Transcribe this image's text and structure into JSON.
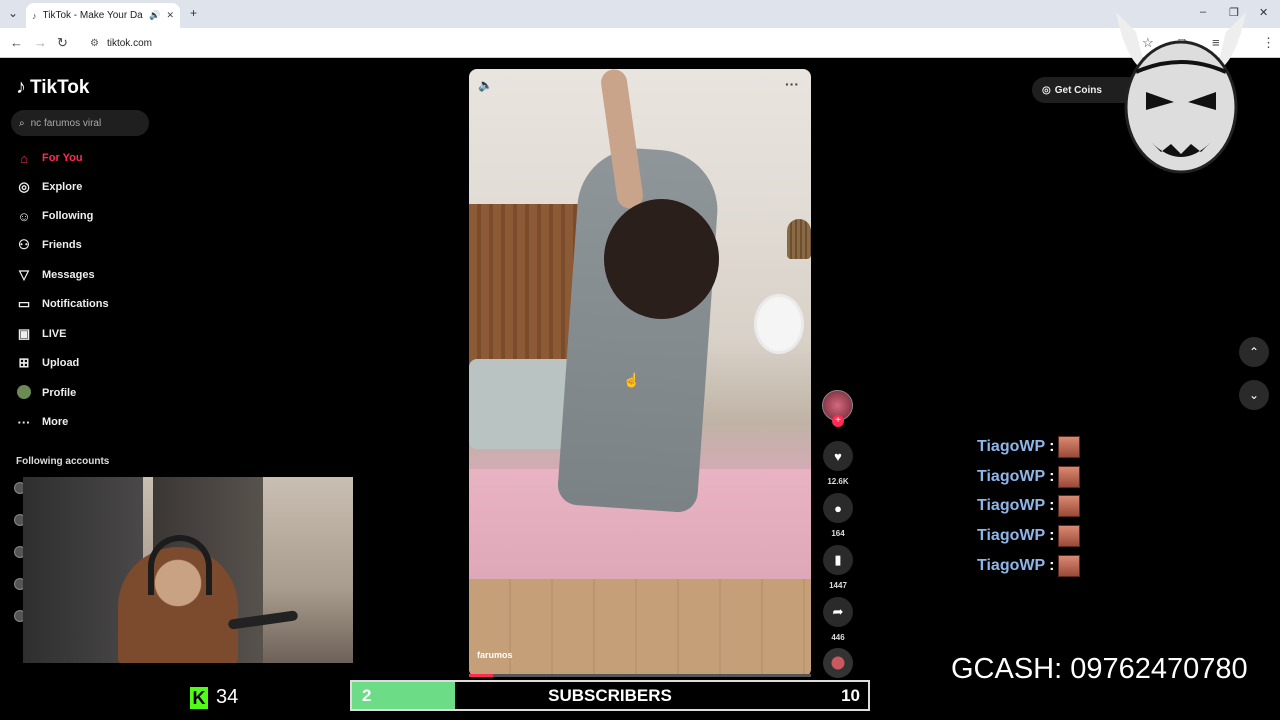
{
  "browser": {
    "tab_title": "TikTok - Make Your Day",
    "url": "tiktok.com"
  },
  "tiktok": {
    "logo_text": "TikTok",
    "search": {
      "value": "nc farumos viral"
    },
    "nav": [
      {
        "label": "For You",
        "icon": "home-icon"
      },
      {
        "label": "Explore",
        "icon": "compass-icon"
      },
      {
        "label": "Following",
        "icon": "person-follow-icon"
      },
      {
        "label": "Friends",
        "icon": "friends-icon"
      },
      {
        "label": "Messages",
        "icon": "send-icon"
      },
      {
        "label": "Notifications",
        "icon": "bell-icon"
      },
      {
        "label": "LIVE",
        "icon": "live-icon"
      },
      {
        "label": "Upload",
        "icon": "plus-square-icon"
      },
      {
        "label": "Profile",
        "icon": "avatar"
      },
      {
        "label": "More",
        "icon": "ellipsis-icon"
      }
    ],
    "following_title": "Following accounts",
    "get_coins": "Get Coins",
    "video": {
      "author": "farumos",
      "progress": 0.07,
      "likes": "12.6K",
      "comments": "164",
      "saves": "1447",
      "shares": "446"
    }
  },
  "stream": {
    "chat": [
      {
        "user": "TiagoWP",
        "sep": ":"
      },
      {
        "user": "TiagoWP",
        "sep": ":"
      },
      {
        "user": "TiagoWP",
        "sep": ":"
      },
      {
        "user": "TiagoWP",
        "sep": ":"
      },
      {
        "user": "TiagoWP",
        "sep": ":"
      }
    ],
    "gcash": "GCASH: 09762470780",
    "kick_viewers": "34",
    "subs": {
      "current": "2",
      "label": "SUBSCRIBERS",
      "goal": "10",
      "fraction": 0.2
    }
  },
  "colors": {
    "accent": "#fe2c55",
    "kick_green": "#53fc18",
    "sub_bar": "#6ddc86",
    "chat_name": "#8fb6e8"
  }
}
